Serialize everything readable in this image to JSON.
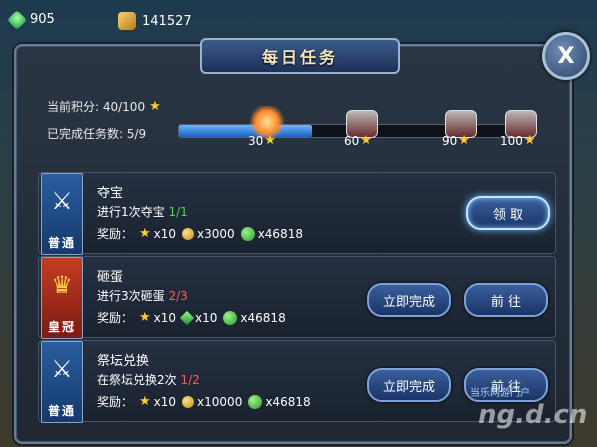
{
  "topbar": {
    "gems": "905",
    "gold": "141527"
  },
  "dialog": {
    "title": "每日任务",
    "close_label": "X",
    "points_label": "当前积分: 40/100",
    "completed_label": "已完成任务数: 5/9",
    "progress_fraction": 0.38,
    "milestones": [
      "30",
      "60",
      "90",
      "100"
    ]
  },
  "tasks": [
    {
      "name": "夺宝",
      "desc": "进行1次夺宝",
      "progress": "1/1",
      "rank": "普通",
      "reward_label": "奖励：",
      "rewards": [
        "x10",
        "x3000",
        "x46818"
      ],
      "buttons": [
        "领 取"
      ]
    },
    {
      "name": "砸蛋",
      "desc": "进行3次砸蛋",
      "progress": "2/3",
      "rank": "皇冠",
      "reward_label": "奖励：",
      "rewards": [
        "x10",
        "x10",
        "x46818"
      ],
      "buttons": [
        "立即完成",
        "前 往"
      ]
    },
    {
      "name": "祭坛兑换",
      "desc": "在祭坛兑换2次",
      "progress": "1/2",
      "rank": "普通",
      "reward_label": "奖励：",
      "rewards": [
        "x10",
        "x10000",
        "x46818"
      ],
      "buttons": [
        "立即完成",
        "前 往"
      ]
    }
  ],
  "watermark": {
    "line1": "当乐网游门户",
    "line2": "ng.d.cn"
  },
  "colors": {
    "star": "#ffcc29",
    "progress_ok": "#55d44f",
    "progress_bad": "#ff5a5a",
    "panel": "#2a3544",
    "button": "#2a4a82"
  },
  "icons": {
    "gem": "gem-icon",
    "gold": "gold-bars-icon",
    "star": "star-icon",
    "coin": "coin-icon",
    "exp": "exp-orb-icon",
    "chest": "treasure-chest-icon",
    "swords": "crossed-swords-icon",
    "crown": "crown-icon"
  }
}
